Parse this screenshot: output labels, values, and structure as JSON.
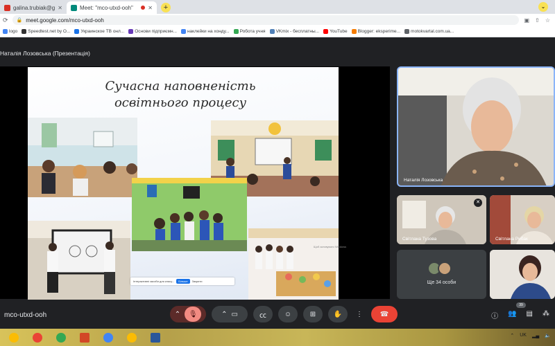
{
  "browser": {
    "tabs": [
      {
        "title": "galina.trubiak@gmail.co",
        "favicon_color": "#d93025"
      },
      {
        "title": "Meet: \"mco-utxd-ooh\"",
        "favicon_color": "#00897b",
        "active": true
      }
    ],
    "new_tab": "+",
    "address": "meet.google.com/mco-utxd-ooh",
    "bookmarks": [
      {
        "label": "logo",
        "color": "#4285f4"
      },
      {
        "label": "Speedtest.net by O...",
        "color": "#333333"
      },
      {
        "label": "Украинское ТВ онл...",
        "color": "#1a73e8"
      },
      {
        "label": "Основи підприємн...",
        "color": "#673ab7"
      },
      {
        "label": "наклейки на хонду...",
        "color": "#4285f4"
      },
      {
        "label": "Робота учня",
        "color": "#34a853"
      },
      {
        "label": "VKmix - бесплатны...",
        "color": "#5181b8"
      },
      {
        "label": "YouTube",
        "color": "#ff0000"
      },
      {
        "label": "Blogger: eksperime...",
        "color": "#f57c00"
      },
      {
        "label": "motokvartal.com.ua...",
        "color": "#5f6368"
      }
    ]
  },
  "meet": {
    "presenter_title": "Наталія Лозовська (Презентація)",
    "slide": {
      "title_line1": "Сучасна наповненість",
      "title_line2": "освітнього процесу",
      "banner_text": "Інтерактивні засоби для класу...",
      "banner_button": "Більше",
      "banner_close": "Закрити",
      "watermark": "Щоб активувати Windows"
    },
    "participants": [
      {
        "name": "Наталія Лозовська"
      },
      {
        "name": "Світлана Тузова"
      },
      {
        "name": "Світлана Рибак"
      }
    ],
    "more_label": "Ще 34 особи",
    "meeting_code": "mco-utxd-ooh",
    "participant_count": "39"
  },
  "taskbar": {
    "language": "UK",
    "apps": [
      {
        "name": "chrome",
        "color": "#fbbc04"
      },
      {
        "name": "chrome",
        "color": "#ea4335"
      },
      {
        "name": "chrome",
        "color": "#34a853"
      },
      {
        "name": "powerpoint",
        "color": "#d24726"
      },
      {
        "name": "chrome",
        "color": "#4285f4"
      },
      {
        "name": "chrome",
        "color": "#fbbc04"
      },
      {
        "name": "word",
        "color": "#2b579a"
      }
    ]
  }
}
